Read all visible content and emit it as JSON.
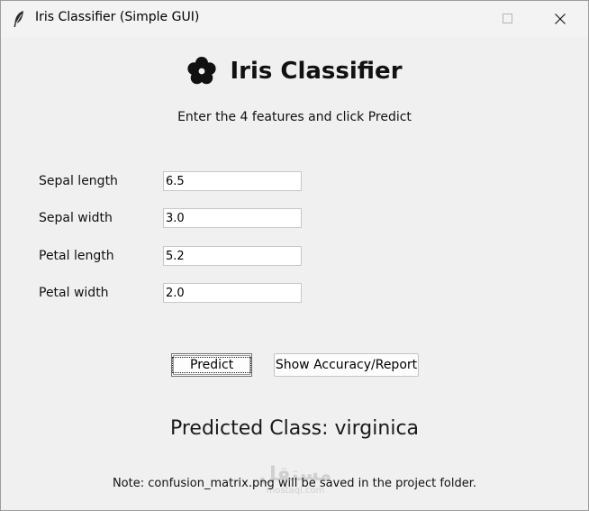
{
  "window": {
    "title": "Iris Classifier (Simple GUI)",
    "app_icon": "feather-icon",
    "controls": [
      "minimize-icon",
      "maximize-icon",
      "close-icon"
    ]
  },
  "header": {
    "icon": "flower-icon",
    "title": "Iris Classifier",
    "instruction": "Enter the 4 features and click Predict"
  },
  "form": {
    "fields": [
      {
        "label": "Sepal length",
        "value": "6.5"
      },
      {
        "label": "Sepal width",
        "value": "3.0"
      },
      {
        "label": "Petal length",
        "value": "5.2"
      },
      {
        "label": "Petal width",
        "value": "2.0"
      }
    ]
  },
  "actions": {
    "predict_label": "Predict",
    "report_label": "Show Accuracy/Report"
  },
  "result": {
    "text": "Predicted Class: virginica"
  },
  "footer": {
    "note": "Note: confusion_matrix.png will be saved in the project folder."
  },
  "watermark": {
    "main": "مستقل",
    "sub": "mostaql.com"
  }
}
